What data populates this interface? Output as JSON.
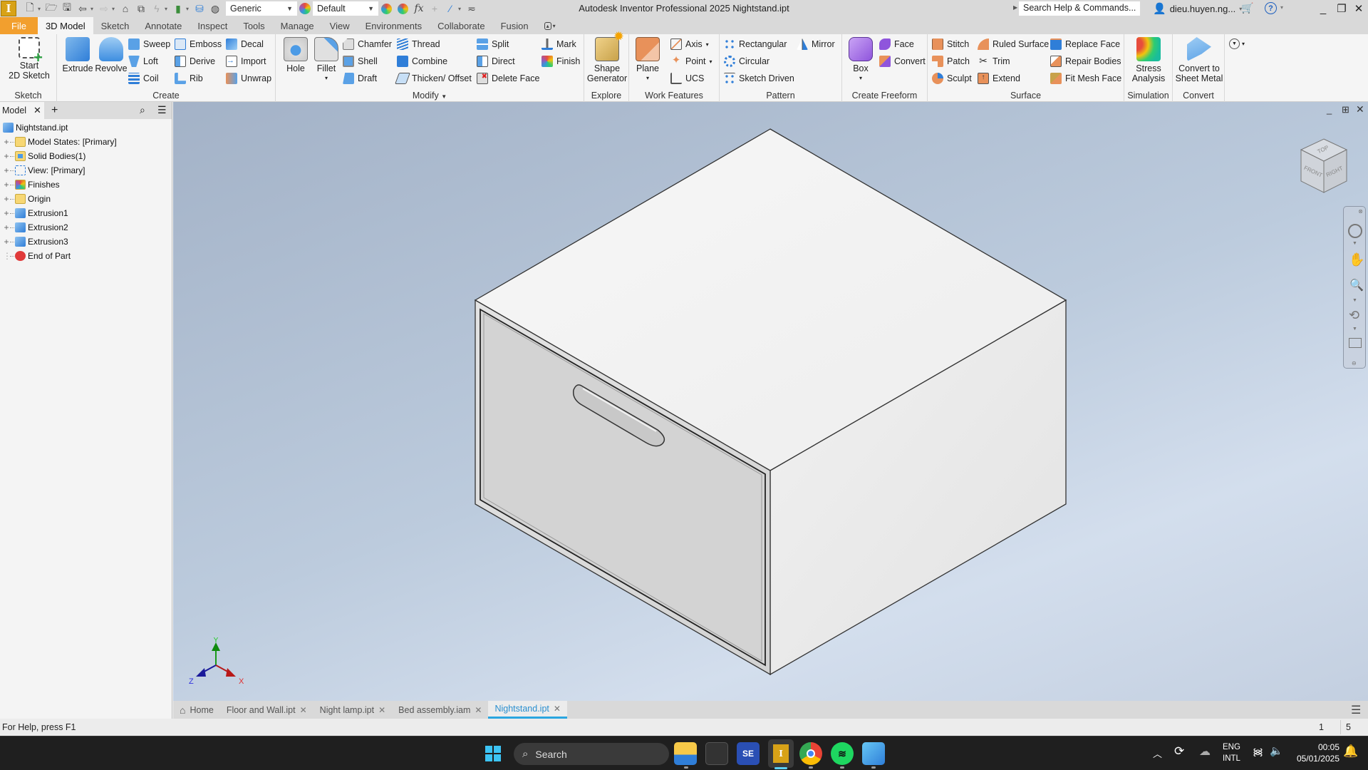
{
  "titlebar": {
    "app_title": "Autodesk Inventor Professional 2025    Nightstand.ipt",
    "appearance_combo": "Generic",
    "material_combo": "Default",
    "search_placeholder": "Search Help & Commands...",
    "user_name": "dieu.huyen.ng..."
  },
  "ribbon_tabs": [
    "File",
    "3D Model",
    "Sketch",
    "Annotate",
    "Inspect",
    "Tools",
    "Manage",
    "View",
    "Environments",
    "Collaborate",
    "Fusion"
  ],
  "active_ribbon_tab": "3D Model",
  "ribbon": {
    "sketch": {
      "label": "Sketch",
      "start_sketch": "Start\n2D Sketch"
    },
    "create": {
      "label": "Create",
      "extrude": "Extrude",
      "revolve": "Revolve",
      "sweep": "Sweep",
      "loft": "Loft",
      "coil": "Coil",
      "emboss": "Emboss",
      "derive": "Derive",
      "rib": "Rib",
      "decal": "Decal",
      "import": "Import",
      "unwrap": "Unwrap"
    },
    "modify": {
      "label": "Modify",
      "hole": "Hole",
      "fillet": "Fillet",
      "chamfer": "Chamfer",
      "shell": "Shell",
      "draft": "Draft",
      "thread": "Thread",
      "combine": "Combine",
      "thicken": "Thicken/ Offset",
      "split": "Split",
      "direct": "Direct",
      "delete_face": "Delete Face",
      "mark": "Mark",
      "finish": "Finish"
    },
    "explore": {
      "label": "Explore",
      "shape_generator": "Shape\nGenerator"
    },
    "work_features": {
      "label": "Work Features",
      "plane": "Plane",
      "axis": "Axis",
      "point": "Point",
      "ucs": "UCS"
    },
    "pattern": {
      "label": "Pattern",
      "rectangular": "Rectangular",
      "circular": "Circular",
      "sketch_driven": "Sketch Driven",
      "mirror": "Mirror"
    },
    "create_freeform": {
      "label": "Create Freeform",
      "box": "Box",
      "face": "Face",
      "convert": "Convert"
    },
    "surface": {
      "label": "Surface",
      "stitch": "Stitch",
      "patch": "Patch",
      "sculpt": "Sculpt",
      "ruled_surface": "Ruled Surface",
      "trim": "Trim",
      "extend": "Extend",
      "replace_face": "Replace Face",
      "repair_bodies": "Repair Bodies",
      "fit_mesh_face": "Fit Mesh Face"
    },
    "simulation": {
      "label": "Simulation",
      "stress_analysis": "Stress\nAnalysis"
    },
    "convert": {
      "label": "Convert",
      "convert_sheet_metal": "Convert to\nSheet Metal"
    }
  },
  "browser": {
    "tab_label": "Model",
    "root": "Nightstand.ipt",
    "nodes": [
      {
        "label": "Model States: [Primary]",
        "icon": "folder-icon"
      },
      {
        "label": "Solid Bodies(1)",
        "icon": "solid-bodies-icon"
      },
      {
        "label": "View: [Primary]",
        "icon": "view-icon"
      },
      {
        "label": "Finishes",
        "icon": "finishes-icon"
      },
      {
        "label": "Origin",
        "icon": "origin-icon"
      },
      {
        "label": "Extrusion1",
        "icon": "extrusion-icon"
      },
      {
        "label": "Extrusion2",
        "icon": "extrusion-icon"
      },
      {
        "label": "Extrusion3",
        "icon": "extrusion-icon"
      },
      {
        "label": "End of Part",
        "icon": "end-of-part-icon"
      }
    ]
  },
  "viewcube": {
    "top": "TOP",
    "front": "FRONT",
    "right": "RIGHT"
  },
  "triad": {
    "x": "X",
    "y": "Y",
    "z": "Z"
  },
  "doc_tabs": [
    {
      "label": "Home",
      "closable": false
    },
    {
      "label": "Floor and Wall.ipt",
      "closable": true
    },
    {
      "label": "Night lamp.ipt",
      "closable": true
    },
    {
      "label": "Bed assembly.iam",
      "closable": true
    },
    {
      "label": "Nightstand.ipt",
      "closable": true,
      "active": true
    }
  ],
  "status": {
    "help": "For Help, press F1",
    "count1": "1",
    "count2": "5"
  },
  "taskbar": {
    "search_label": "Search",
    "lang1": "ENG",
    "lang2": "INTL",
    "time": "00:05",
    "date": "05/01/2025"
  },
  "colors": {
    "file_tab": "#f29f2e",
    "active_doc_tab": "#2aa6e0",
    "accent_orange": "#e8915a",
    "freeform_purple": "#a36ee0"
  }
}
